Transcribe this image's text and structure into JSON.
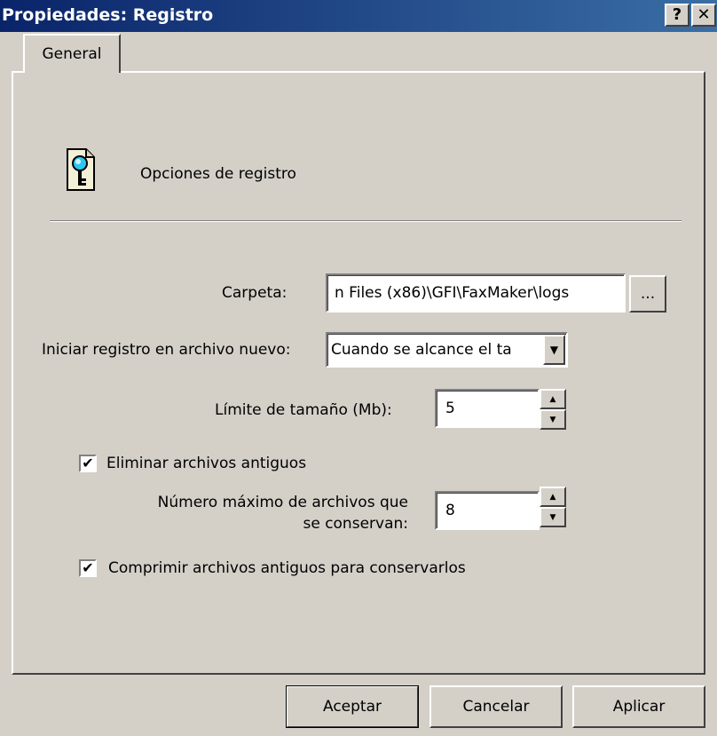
{
  "window": {
    "title": "Propiedades: Registro",
    "help_label": "?",
    "close_label": "✕"
  },
  "tabs": [
    {
      "label": "General",
      "selected": true
    }
  ],
  "section": {
    "title": "Opciones de registro",
    "icon": "log-document-icon"
  },
  "folder": {
    "label": "Carpeta:",
    "value": "n Files (x86)\\GFI\\FaxMaker\\logs",
    "browse_label": "..."
  },
  "new_log": {
    "label": "Iniciar registro en archivo nuevo:",
    "value": "Cuando se alcance el ta",
    "arrow": "▼"
  },
  "size_limit": {
    "label": "Límite de tamaño (Mb):",
    "value": "5"
  },
  "delete_old": {
    "checked": true,
    "label": "Eliminar archivos antiguos",
    "check_glyph": "✔"
  },
  "max_files": {
    "label_line1": "Número máximo de archivos que",
    "label_line2": "se conservan:",
    "value": "8"
  },
  "compress_old": {
    "checked": true,
    "label": "Comprimir archivos antiguos para conservarlos",
    "check_glyph": "✔"
  },
  "spin": {
    "up": "▲",
    "down": "▼"
  },
  "buttons": {
    "ok": "Aceptar",
    "cancel": "Cancelar",
    "apply": "Aplicar"
  }
}
